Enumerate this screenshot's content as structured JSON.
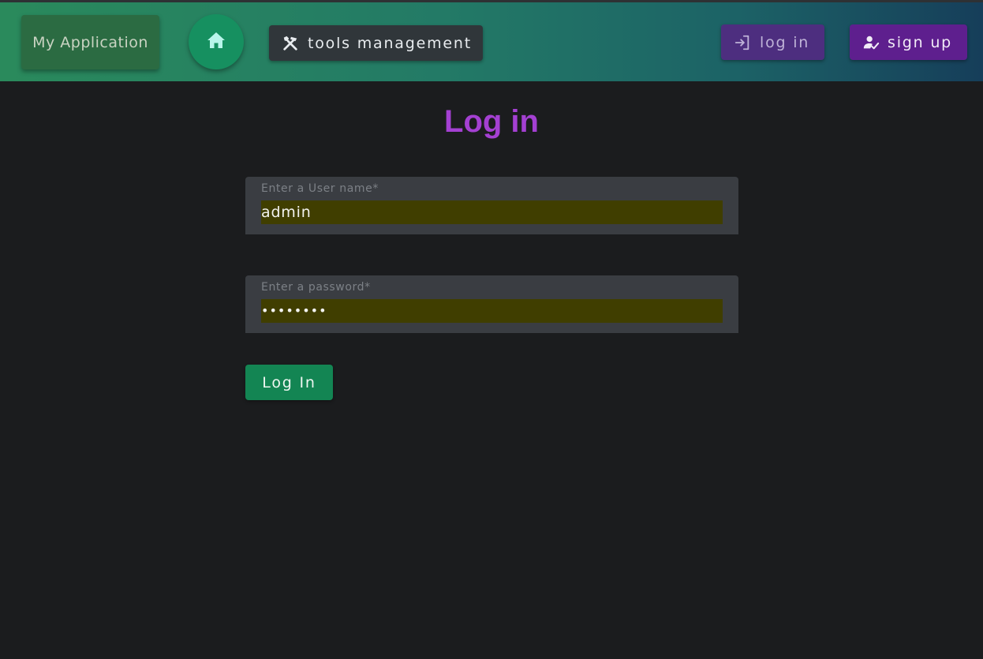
{
  "header": {
    "brand": "My Application",
    "home_icon": "home-icon",
    "tools_label": "tools management",
    "tools_icon": "tools-icon",
    "login_label": "log in",
    "login_icon": "login-icon",
    "signup_label": "sign up",
    "signup_icon": "person-check-icon"
  },
  "main": {
    "title": "Log in",
    "username": {
      "label": "Enter a User name*",
      "value": "admin"
    },
    "password": {
      "label": "Enter a password*",
      "value": "••••••••"
    },
    "submit_label": "Log In"
  },
  "colors": {
    "header_gradient_start": "#2a8a5c",
    "header_gradient_end": "#163e5a",
    "page_background": "#1b1c1e",
    "title": "#a440d2",
    "submit_button": "#138553",
    "signup_button": "#5e1f8e",
    "login_button": "#4d2e7f",
    "autofill_background": "#403e00"
  }
}
